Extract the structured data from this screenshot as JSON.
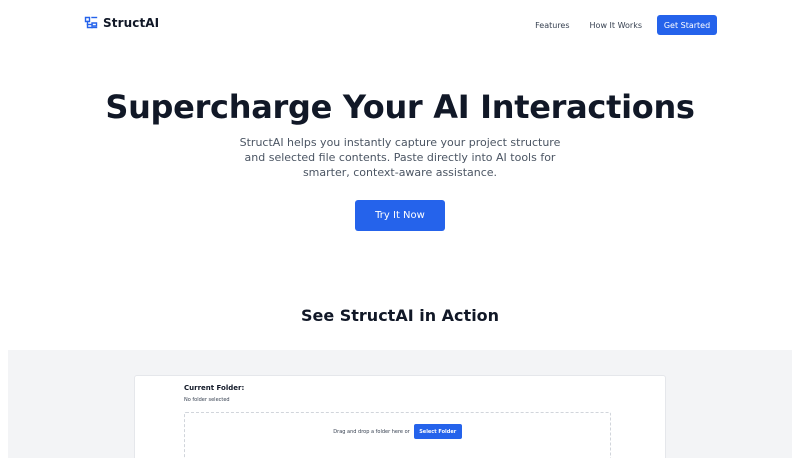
{
  "header": {
    "brand_name": "StructAI",
    "brand_icon": "structure-icon",
    "nav": {
      "features": "Features",
      "how_it_works": "How It Works",
      "get_started": "Get Started"
    }
  },
  "hero": {
    "title": "Supercharge Your AI Interactions",
    "subtitle": "StructAI helps you instantly capture your project structure and selected file contents. Paste directly into AI tools for smarter, context-aware assistance.",
    "cta": "Try It Now"
  },
  "demo": {
    "title": "See StructAI in Action",
    "current_folder_label": "Current Folder:",
    "current_folder_value": "No folder selected",
    "dropzone_text": "Drag and drop a folder here or",
    "select_button": "Select Folder"
  },
  "colors": {
    "accent": "#2563eb",
    "text_dark": "#111827",
    "text_muted": "#4b5563",
    "section_bg": "#f3f4f6"
  }
}
